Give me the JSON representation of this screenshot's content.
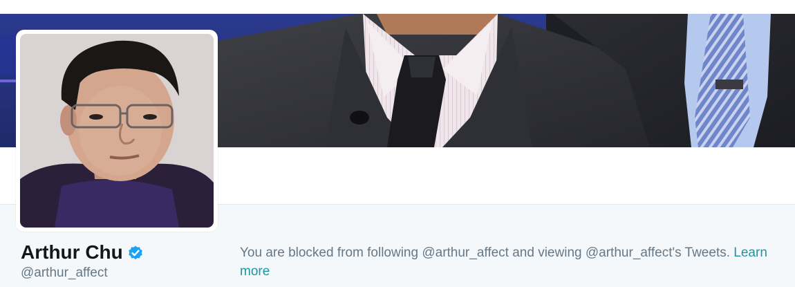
{
  "profile": {
    "name": "Arthur Chu",
    "handle": "@arthur_affect",
    "verified": true
  },
  "blocked_notice": {
    "message": "You are blocked from following @arthur_affect and viewing @arthur_affect's Tweets.",
    "learn_more_label": "Learn more"
  },
  "icons": {
    "verified": "verified-badge-icon"
  },
  "colors": {
    "accent_link": "#1b95a3",
    "verified_blue": "#1da1f2",
    "secondary_text": "#657786",
    "name_text": "#14171a",
    "profile_bar_bg": "#f5f8fa"
  }
}
